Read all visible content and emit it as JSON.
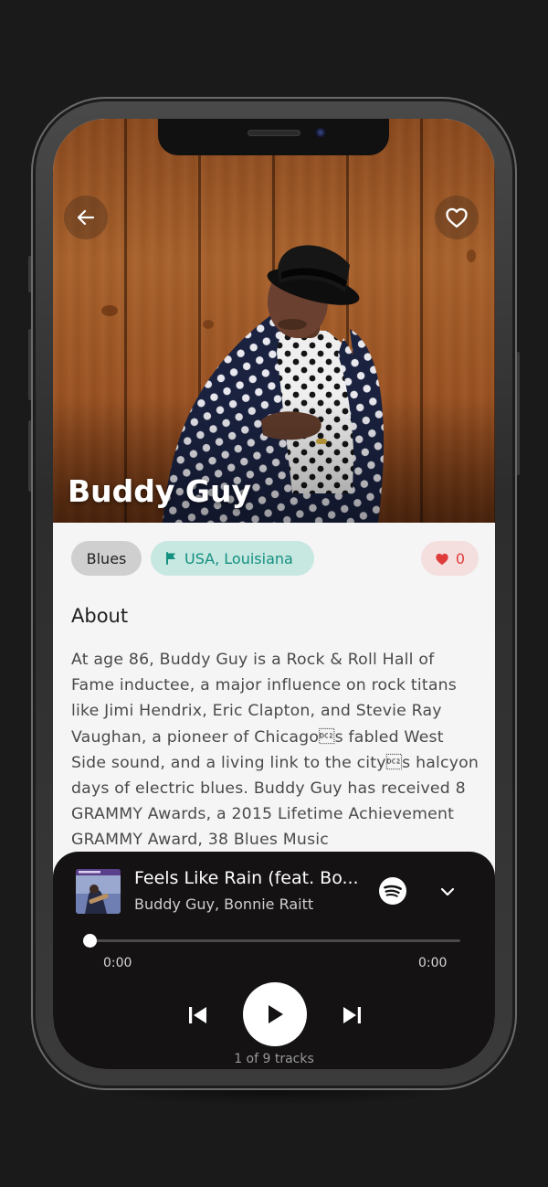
{
  "artist": {
    "name": "Buddy Guy",
    "genre": "Blues",
    "location": "USA, Louisiana",
    "likes": "0"
  },
  "about": {
    "title": "About",
    "text": "At age 86, Buddy Guy is a Rock & Roll Hall of Fame inductee, a major influence on rock titans like Jimi Hendrix, Eric Clapton, and Stevie Ray Vaughan, a pioneer of Chicago\u0012s fabled West Side sound, and a living link to the city\u0012s halcyon days of electric blues. Buddy Guy has received 8 GRAMMY Awards, a 2015 Lifetime Achievement GRAMMY Award, 38 Blues Music"
  },
  "player": {
    "track_title": "Feels Like Rain (feat. Bo...",
    "track_artists": "Buddy Guy, Bonnie Raitt",
    "elapsed": "0:00",
    "duration": "0:00",
    "progress": 0,
    "track_count": "1 of 9 tracks"
  },
  "icons": {
    "back": "arrow-left-icon",
    "favorite": "heart-outline-icon",
    "location": "flag-icon",
    "likes": "heart-filled-icon",
    "spotify": "spotify-icon",
    "collapse": "chevron-down-icon",
    "previous": "skip-previous-icon",
    "play": "play-icon",
    "next": "skip-next-icon"
  },
  "colors": {
    "location_tag_text": "#13907f",
    "likes_tag_text": "#e03b3b",
    "player_background": "#141213"
  }
}
